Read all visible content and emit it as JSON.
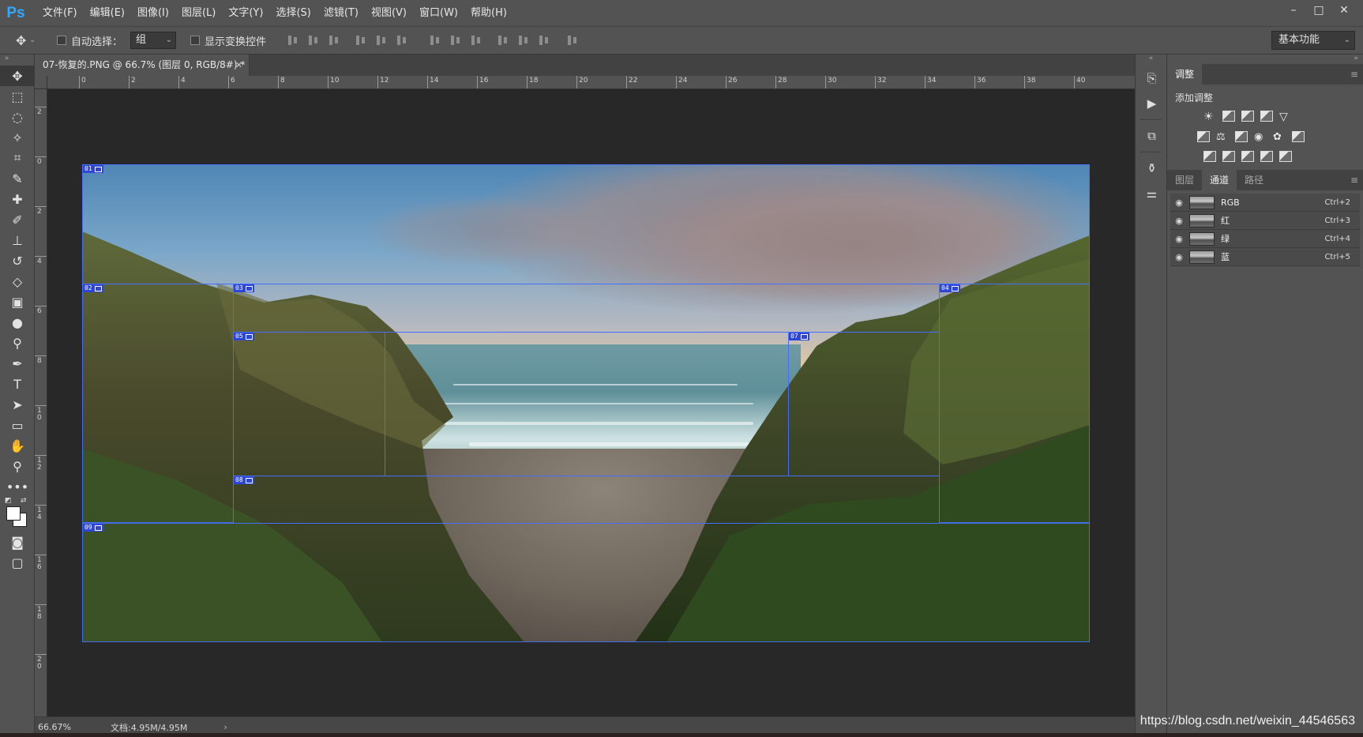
{
  "app": {
    "logo": "Ps"
  },
  "menu": [
    "文件(F)",
    "编辑(E)",
    "图像(I)",
    "图层(L)",
    "文字(Y)",
    "选择(S)",
    "滤镜(T)",
    "视图(V)",
    "窗口(W)",
    "帮助(H)"
  ],
  "window_controls": {
    "minimize": "–",
    "maximize": "□",
    "close": "✕"
  },
  "options": {
    "auto_select_label": "自动选择：",
    "auto_select_value": "组",
    "show_transform_label": "显示变换控件",
    "workspace": "基本功能"
  },
  "document": {
    "tab_title": "07-恢复的.PNG @ 66.7% (图层 0, RGB/8#) *",
    "close": "✕"
  },
  "ruler": {
    "h_labels": [
      "0",
      "2",
      "4",
      "6",
      "8",
      "10",
      "12",
      "14",
      "16",
      "18",
      "20",
      "22",
      "24",
      "26",
      "28",
      "30",
      "32",
      "34",
      "36",
      "38",
      "40"
    ],
    "v_labels": [
      "2",
      "0",
      "2",
      "4",
      "6",
      "8",
      "10",
      "12",
      "14",
      "16",
      "18",
      "20"
    ]
  },
  "slices": [
    "01",
    "02",
    "03",
    "04",
    "05",
    "07",
    "08",
    "09"
  ],
  "status": {
    "zoom": "66.67%",
    "doc_size": "文档:4.95M/4.95M",
    "arrow": "›"
  },
  "adjustments": {
    "tab": "调整",
    "add_label": "添加调整"
  },
  "channels_panel": {
    "tabs": [
      "图层",
      "通道",
      "路径"
    ],
    "channels": [
      {
        "name": "RGB",
        "shortcut": "Ctrl+2"
      },
      {
        "name": "红",
        "shortcut": "Ctrl+3"
      },
      {
        "name": "绿",
        "shortcut": "Ctrl+4"
      },
      {
        "name": "蓝",
        "shortcut": "Ctrl+5"
      }
    ]
  },
  "watermark": "https://blog.csdn.net/weixin_44546563"
}
